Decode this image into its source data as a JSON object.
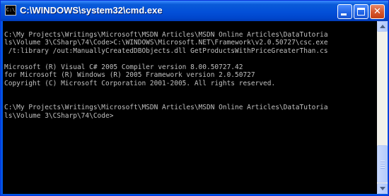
{
  "window": {
    "title": "C:\\WINDOWS\\system32\\cmd.exe",
    "app_icon_text": "C:\\",
    "buttons": {
      "minimize": "minimize",
      "maximize": "maximize",
      "close": "close"
    }
  },
  "console": {
    "lines": [
      "",
      "C:\\My Projects\\Writings\\Microsoft\\MSDN Articles\\MSDN Online Articles\\DataTutoria",
      "ls\\Volume 3\\CSharp\\74\\Code>C:\\WINDOWS\\Microsoft.NET\\Framework\\v2.0.50727\\csc.exe",
      " /t:library /out:ManuallyCreatedDBObjects.dll GetProductsWithPriceGreaterThan.cs",
      "",
      "Microsoft (R) Visual C# 2005 Compiler version 8.00.50727.42",
      "for Microsoft (R) Windows (R) 2005 Framework version 2.0.50727",
      "Copyright (C) Microsoft Corporation 2001-2005. All rights reserved.",
      "",
      "",
      "C:\\My Projects\\Writings\\Microsoft\\MSDN Articles\\MSDN Online Articles\\DataTutoria",
      "ls\\Volume 3\\CSharp\\74\\Code>"
    ]
  },
  "colors": {
    "titlebar": "#0054e3",
    "console_bg": "#000000",
    "console_fg": "#c0c0c0",
    "close_button": "#d5552c"
  }
}
